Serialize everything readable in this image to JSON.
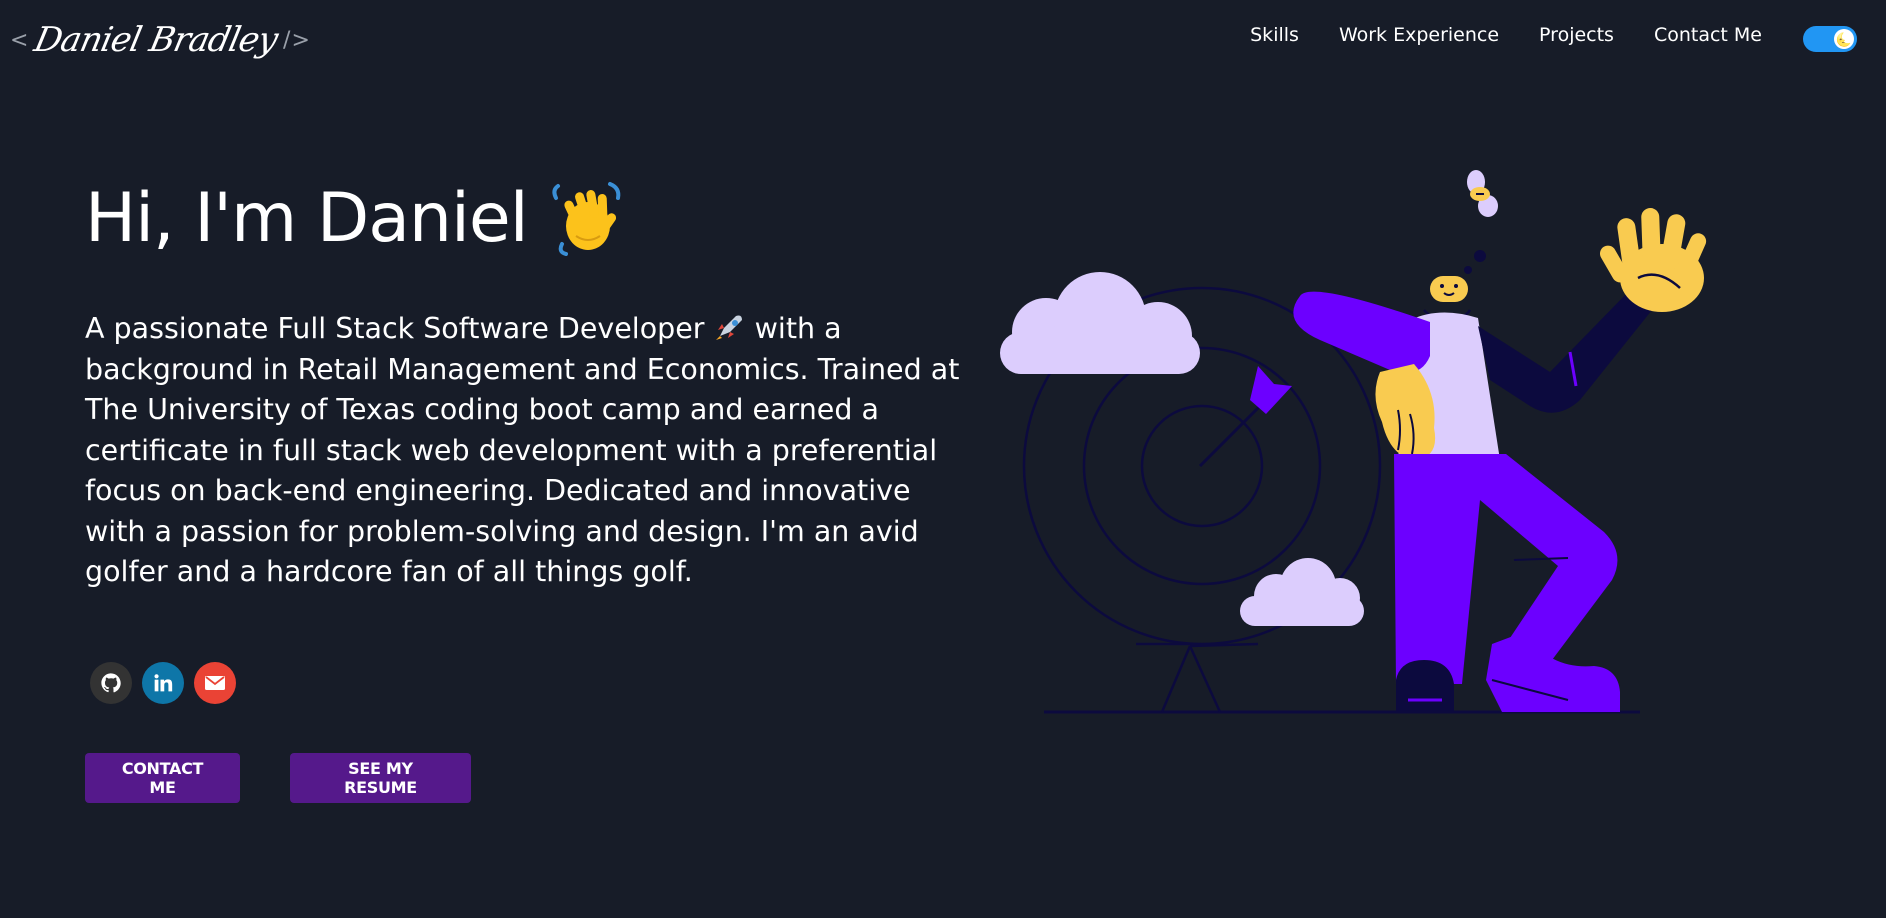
{
  "header": {
    "logo_left": "<",
    "logo_signature": "Daniel Bradley",
    "logo_right": "/>",
    "nav": [
      "Skills",
      "Work Experience",
      "Projects",
      "Contact Me"
    ],
    "theme_toggle_icon": "moon-icon"
  },
  "hero": {
    "greeting": "Hi, I'm Daniel",
    "greeting_icon": "waving-hand-icon",
    "bio_part1": "A passionate Full Stack Software Developer ",
    "bio_icon": "rocket-icon",
    "bio_part2": " with a background in Retail Management and Economics. Trained at The University of Texas coding boot camp and earned a certificate in full stack web development with a preferential focus on back-end engineering. Dedicated and innovative with a passion for problem-solving and design. I'm an avid golfer and a hardcore fan of all things golf.",
    "socials": [
      "github-icon",
      "linkedin-icon",
      "mail-icon"
    ],
    "contact_button": "CONTACT ME",
    "resume_button": "SEE MY RESUME"
  },
  "colors": {
    "background": "#171c28",
    "button": "#55198b",
    "toggle": "#2196f3",
    "github": "#333333",
    "linkedin": "#0e76a8",
    "mail": "#ea4335",
    "illustration_purple": "#6c00ff",
    "illustration_lavender": "#dccdfd",
    "illustration_yellow": "#f9cb50"
  }
}
